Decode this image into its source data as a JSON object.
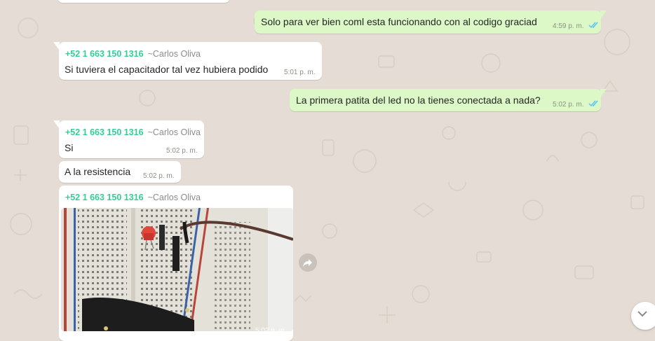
{
  "messages": [
    {
      "text": "Solo para ver bien coml esta funcionando con al codigo graciad",
      "time": "4:59 p. m."
    },
    {
      "phone": "+52 1 663 150 1316",
      "alias": "~Carlos Oliva",
      "text": "Si tuviera el capacitador tal vez hubiera podido",
      "time": "5:01 p. m."
    },
    {
      "text": "La primera patita del led no la tienes conectada a nada?",
      "time": "5:02 p. m."
    },
    {
      "phone": "+52 1 663 150 1316",
      "alias": "~Carlos Oliva",
      "text": "Si",
      "time": "5:02 p. m."
    },
    {
      "text": "A la resistencia",
      "time": "5:02 p. m."
    },
    {
      "phone": "+52 1 663 150 1316",
      "alias": "~Carlos Oliva",
      "time": "5:02 p. m."
    }
  ],
  "colors": {
    "chat_bg": "#e5ddd5",
    "outgoing": "#dcf8c6",
    "incoming": "#ffffff",
    "sender": "#35cd96",
    "read_ticks": "#4fc3f7"
  },
  "icons": {
    "read": "double-check-icon",
    "forward": "forward-icon",
    "scroll": "chevron-down-icon"
  }
}
